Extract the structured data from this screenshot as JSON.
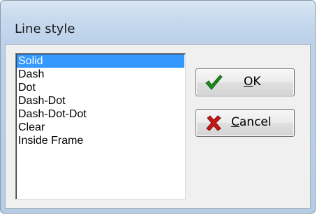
{
  "dialog": {
    "title": "Line style"
  },
  "list": {
    "items": [
      {
        "label": "Solid",
        "selected": true
      },
      {
        "label": "Dash",
        "selected": false
      },
      {
        "label": "Dot",
        "selected": false
      },
      {
        "label": "Dash-Dot",
        "selected": false
      },
      {
        "label": "Dash-Dot-Dot",
        "selected": false
      },
      {
        "label": "Clear",
        "selected": false
      },
      {
        "label": "Inside Frame",
        "selected": false
      }
    ]
  },
  "buttons": {
    "ok": {
      "mnemonic": "O",
      "rest": "K",
      "icon": "check-icon"
    },
    "cancel": {
      "mnemonic": "C",
      "rest": "ancel",
      "icon": "x-icon"
    }
  },
  "colors": {
    "selection": "#3399ff",
    "check": "#1c8c1c",
    "cross": "#c81818"
  }
}
